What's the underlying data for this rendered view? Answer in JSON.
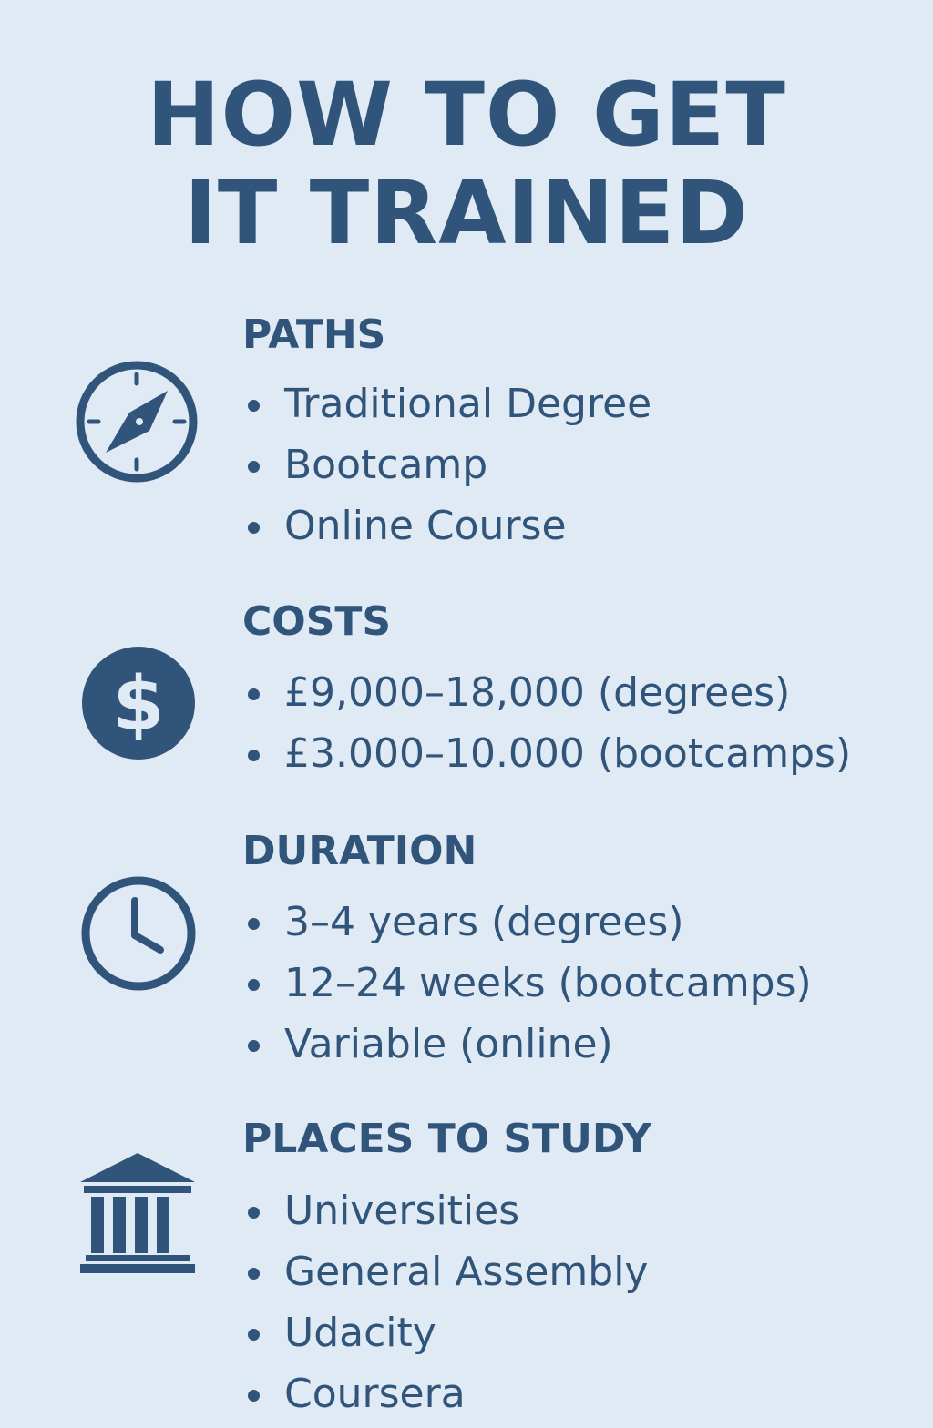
{
  "title": {
    "line1": "HOW TO GET",
    "line2": "IT TRAINED"
  },
  "colors": {
    "background": "#dfeaf4",
    "primary": "#30547a"
  },
  "sections": [
    {
      "heading": "PATHS",
      "icon": "compass-icon",
      "items": [
        "Traditional Degree",
        "Bootcamp",
        "Online Course"
      ]
    },
    {
      "heading": "COSTS",
      "icon": "dollar-circle-icon",
      "items": [
        "£9,000–18,000 (degrees)",
        "£3.000–10.000 (bootcamps)"
      ]
    },
    {
      "heading": "DURATION",
      "icon": "clock-icon",
      "items": [
        "3–4 years (degrees)",
        "12–24 weeks (bootcamps)",
        "Variable (online)"
      ]
    },
    {
      "heading": "PLACES TO STUDY",
      "icon": "institution-icon",
      "items": [
        "Universities",
        "General Assembly",
        "Udacity",
        "Coursera"
      ]
    }
  ]
}
